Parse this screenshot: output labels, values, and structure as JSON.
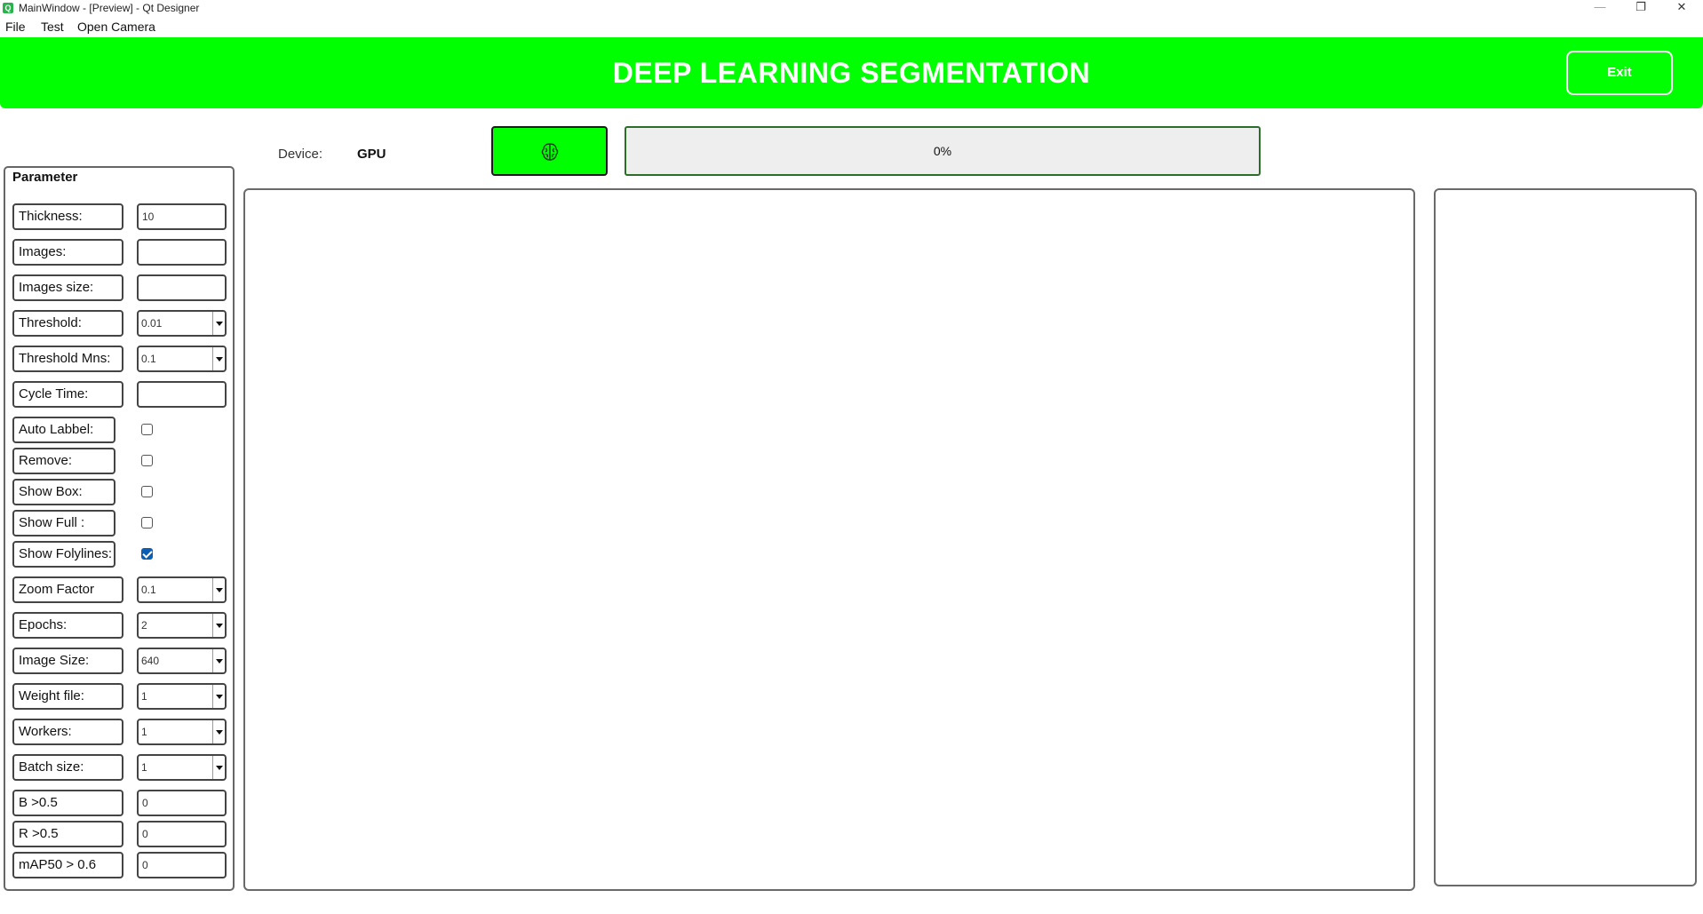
{
  "window": {
    "title": "MainWindow - [Preview] - Qt Designer",
    "app_icon": "qt-designer-icon",
    "minimize_glyph": "—",
    "restore_glyph": "❐",
    "close_glyph": "✕"
  },
  "menubar": {
    "items": [
      "File",
      "Test",
      "Open Camera"
    ]
  },
  "header": {
    "title": "DEEP LEARNING SEGMENTATION",
    "exit_label": "Exit",
    "background_color": "#00ff00"
  },
  "toolbar": {
    "device_label": "Device:",
    "device_value": "GPU",
    "run_icon": "brain-icon",
    "progress_text": "0%",
    "progress_value": 0
  },
  "parameters": {
    "group_title": "Parameter",
    "thickness": {
      "label": "Thickness:",
      "value": "10"
    },
    "images": {
      "label": "Images:",
      "value": ""
    },
    "images_size": {
      "label": "Images size:",
      "value": ""
    },
    "threshold": {
      "label": "Threshold:",
      "value": "0.01"
    },
    "threshold_mns": {
      "label": "Threshold Mns:",
      "value": "0.1"
    },
    "cycle_time": {
      "label": "Cycle Time:",
      "value": ""
    },
    "auto_label": {
      "label": "Auto Labbel:",
      "checked": false
    },
    "remove": {
      "label": "Remove:",
      "checked": false
    },
    "show_box": {
      "label": "Show Box:",
      "checked": false
    },
    "show_full": {
      "label": "Show Full :",
      "checked": false
    },
    "show_polylines": {
      "label": "Show Folylines:",
      "checked": true
    },
    "zoom_factor": {
      "label": "Zoom Factor",
      "value": "0.1"
    },
    "epochs": {
      "label": "Epochs:",
      "value": "2"
    },
    "image_size": {
      "label": "Image Size:",
      "value": "640"
    },
    "weight_file": {
      "label": "Weight file:",
      "value": "1"
    },
    "workers": {
      "label": "Workers:",
      "value": "1"
    },
    "batch_size": {
      "label": "Batch size:",
      "value": "1"
    },
    "b_metric": {
      "label": "B >0.5",
      "value": "0"
    },
    "r_metric": {
      "label": "R >0.5",
      "value": "0"
    },
    "map_metric": {
      "label": "mAP50 > 0.6",
      "value": "0"
    }
  }
}
